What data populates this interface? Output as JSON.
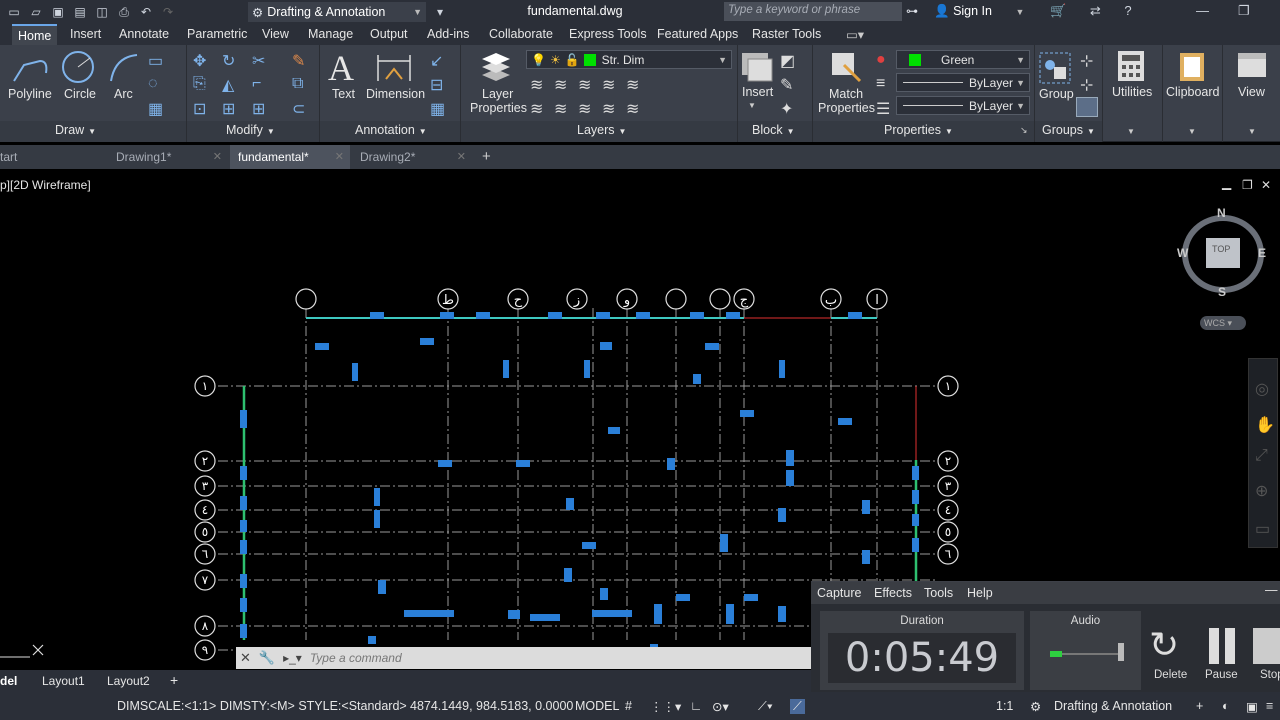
{
  "titlebar": {
    "workspace": "Drafting & Annotation",
    "filename": "fundamental.dwg",
    "search_placeholder": "Type a keyword or phrase",
    "signin": "Sign In"
  },
  "ribbon_tabs": [
    "Home",
    "Insert",
    "Annotate",
    "Parametric",
    "View",
    "Manage",
    "Output",
    "Add-ins",
    "Collaborate",
    "Express Tools",
    "Featured Apps",
    "Raster Tools"
  ],
  "ribbon": {
    "draw": {
      "polyline": "Polyline",
      "circle": "Circle",
      "arc": "Arc",
      "title": "Draw"
    },
    "modify": {
      "title": "Modify"
    },
    "annotation": {
      "text": "Text",
      "dimension": "Dimension",
      "title": "Annotation"
    },
    "layers": {
      "layer_properties_1": "Layer",
      "layer_properties_2": "Properties",
      "current_layer": "Str. Dim",
      "title": "Layers"
    },
    "block": {
      "insert": "Insert",
      "title": "Block"
    },
    "properties": {
      "match_1": "Match",
      "match_2": "Properties",
      "color": "Green",
      "linetype": "ByLayer",
      "lineweight": "ByLayer",
      "title": "Properties"
    },
    "groups": {
      "group": "Group",
      "title": "Groups"
    },
    "utilities": "Utilities",
    "clipboard": "Clipboard",
    "view": "View"
  },
  "doc_tabs": [
    "tart",
    "Drawing1*",
    "fundamental*",
    "Drawing2*"
  ],
  "viewport": {
    "label": "p][2D Wireframe]",
    "viewcube_top": "TOP",
    "compass": {
      "n": "N",
      "s": "S",
      "e": "E",
      "w": "W"
    },
    "wcs": "WCS",
    "grid_top_labels": [
      "",
      "ط",
      "ح",
      "ز",
      "و",
      "",
      "",
      "ج",
      "ب",
      "ا"
    ],
    "grid_side_labels": [
      "۱",
      "۲",
      "۳",
      "٤",
      "٥",
      "٦",
      "۷",
      "۸",
      "۹"
    ]
  },
  "command": {
    "placeholder": "Type a command"
  },
  "layout_tabs": [
    "del",
    "Layout1",
    "Layout2"
  ],
  "statusbar": {
    "dimscale": "DIMSCALE:<1:1> DIMSTY:<M> STYLE:<Standard>",
    "coords": "4874.1449, 984.5183, 0.0000",
    "model": "MODEL",
    "workspace": "Drafting & Annotation",
    "scale": "1:1"
  },
  "recorder": {
    "menu": [
      "Capture",
      "Effects",
      "Tools",
      "Help"
    ],
    "duration_label": "Duration",
    "duration": "0:05:49",
    "audio_label": "Audio",
    "delete": "Delete",
    "pause": "Pause",
    "stop": "Stop"
  }
}
